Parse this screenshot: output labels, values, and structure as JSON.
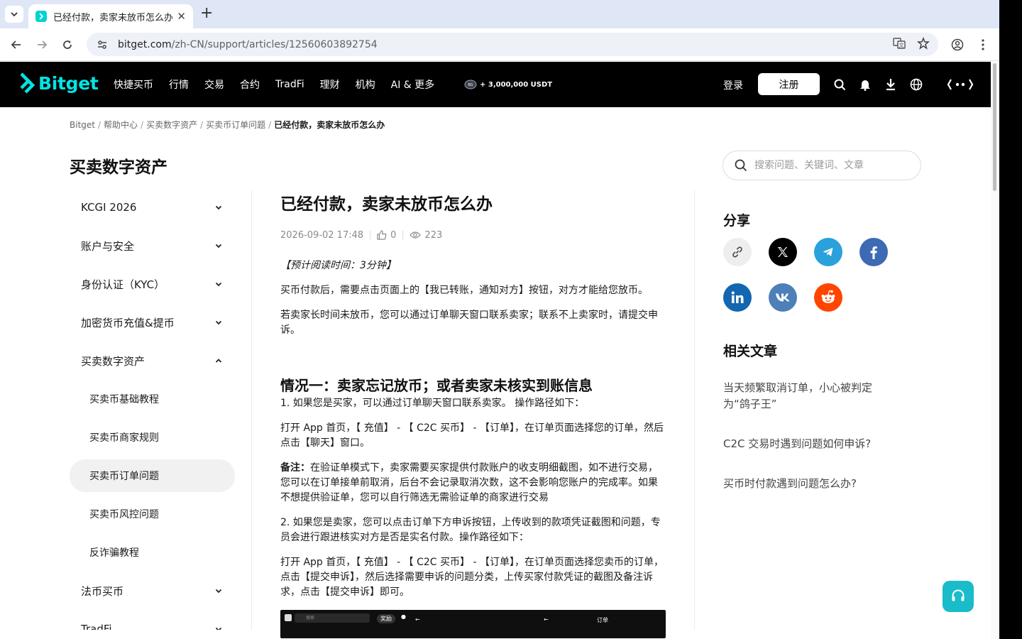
{
  "browser": {
    "tab_title": "已经付款，卖家未放币怎么办",
    "url_host": "bitget.com",
    "url_path": "/zh-CN/support/articles/12560603892754"
  },
  "header": {
    "logo": "Bitget",
    "nav": [
      "快捷买币",
      "行情",
      "交易",
      "合约",
      "TradFi",
      "理财",
      "机构",
      "AI & 更多"
    ],
    "promo": "+ 3,000,000 USDT",
    "login": "登录",
    "signup": "注册"
  },
  "breadcrumb": [
    "Bitget",
    "帮助中心",
    "买卖数字资产",
    "买卖币订单问题",
    "已经付款，卖家未放币怎么办"
  ],
  "section_title": "买卖数字资产",
  "sidebar": {
    "categories_top": [
      "KCGI 2026",
      "账户与安全",
      "身份认证（KYC）",
      "加密货币充值&提币"
    ],
    "open_category": "买卖数字资产",
    "sub_items": [
      "买卖币基础教程",
      "买卖币商家规则",
      "买卖币订单问题",
      "买卖币风控问题",
      "反诈骗教程"
    ],
    "categories_bottom": [
      "法币买币",
      "TradFi"
    ]
  },
  "article": {
    "title": "已经付款，卖家未放币怎么办",
    "date": "2026-09-02 17:48",
    "likes": "0",
    "views": "223",
    "reading_time": "【预计阅读时间：3分钟】",
    "p1": "买币付款后，需要点击页面上的【我已转账，通知对方】按钮，对方才能给您放币。",
    "p2": "若卖家长时间未放币，您可以通过订单聊天窗口联系卖家；联系不上卖家时，请提交申诉。",
    "h1": "情况一：卖家忘记放币；或者卖家未核实到账信息",
    "p3": "1. 如果您是买家，可以通过订单聊天窗口联系卖家。 操作路径如下：",
    "p4": "打开 App 首页，【 充值】 - 【 C2C 买币】 - 【订单】，在订单页面选择您的订单，然后点击【聊天】窗口。",
    "note_label": "备注：",
    "note": "在验证单模式下，卖家需要买家提供付款账户的收支明细截图，如不进行交易，您可以在订单接单前取消，后台不会记录取消次数，这不会影响您账户的完成率。如果不想提供验证单，您可以自行筛选无需验证单的商家进行交易",
    "p5": "2. 如果您是卖家，您可以点击订单下方申诉按钮，上传收到的款项凭证截图和问题，专员会进行跟进核实对方是否是实名付款。操作路径如下：",
    "p6": "打开 App 首页，【 充值】 - 【 C2C 买币】 - 【订单】，在订单页面选择您卖币的订单，点击【提交申诉】，然后选择需要申诉的问题分类，上传买家付款凭证的截图及备注诉求，点击【提交申诉】即可。",
    "shot_search": "搜索",
    "shot_tag": "奖励",
    "shot_order": "订单"
  },
  "right": {
    "search_placeholder": "搜索问题、关键词、文章",
    "share_title": "分享",
    "related_title": "相关文章",
    "related": [
      "当天频繁取消订单，小心被判定为“鸽子王”",
      "C2C 交易时遇到问题如何申诉?",
      "买币时付款遇到问题怎么办?"
    ]
  },
  "colors": {
    "brand": "#00e5e5",
    "telegram": "#2aa1da",
    "facebook": "#3d6ab3",
    "linkedin": "#1366b0",
    "vk": "#4d7fb8",
    "reddit": "#ff4500",
    "help": "#19bcc8"
  }
}
